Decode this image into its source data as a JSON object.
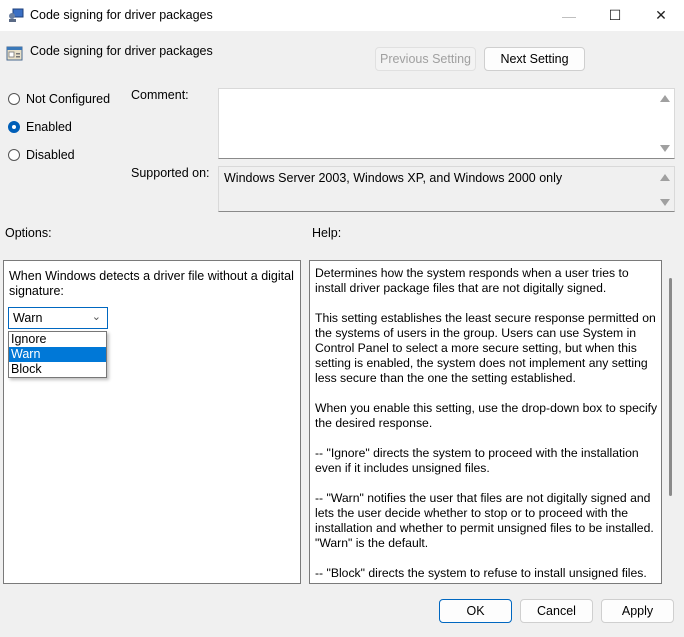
{
  "window": {
    "title": "Code signing for driver packages",
    "controls": {
      "minimize": "—",
      "maximize": "☐",
      "close": "✕"
    }
  },
  "header": {
    "title": "Code signing for driver packages",
    "previous_label": "Previous Setting",
    "next_label": "Next Setting"
  },
  "state": {
    "options": [
      {
        "label": "Not Configured",
        "checked": false
      },
      {
        "label": "Enabled",
        "checked": true
      },
      {
        "label": "Disabled",
        "checked": false
      }
    ]
  },
  "comment": {
    "label": "Comment:",
    "value": ""
  },
  "supported": {
    "label": "Supported on:",
    "value": "Windows Server 2003, Windows XP, and Windows 2000 only"
  },
  "options_section": {
    "label": "Options:",
    "prompt": "When Windows detects a driver file without a digital signature:",
    "selected": "Warn",
    "choices": [
      "Ignore",
      "Warn",
      "Block"
    ]
  },
  "help_section": {
    "label": "Help:",
    "paragraphs": [
      "Determines how the system responds when a user tries to install driver package files that are not digitally signed.",
      "This setting establishes the least secure response permitted on the systems of users in the group. Users can use System in Control Panel to select a more secure setting, but when this setting is enabled, the system does not implement any setting less secure than the one the setting established.",
      "When you enable this setting, use the drop-down box to specify the desired response.",
      "--   \"Ignore\" directs the system to proceed with the installation even if it includes unsigned files.",
      "--   \"Warn\" notifies the user that files are not digitally signed and lets the user decide whether to stop or to proceed with the installation and whether to permit unsigned files to be installed. \"Warn\" is the default.",
      "--   \"Block\" directs the system to refuse to install unsigned files."
    ]
  },
  "footer": {
    "ok_label": "OK",
    "cancel_label": "Cancel",
    "apply_label": "Apply"
  },
  "colors": {
    "accent": "#0067c0",
    "selection": "#0078d7"
  }
}
